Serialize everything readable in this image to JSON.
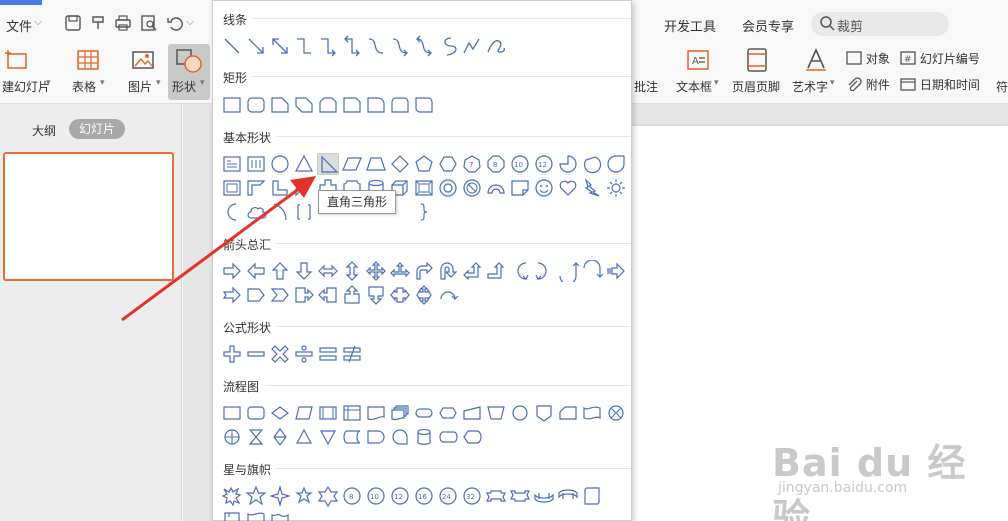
{
  "menubar": {
    "file": "文件",
    "dev_tools": "开发工具",
    "member": "会员专享",
    "search_placeholder": "裁剪"
  },
  "ribbon": {
    "new_slide": "建幻灯片",
    "table": "表格",
    "picture": "图片",
    "shape": "形状",
    "comment": "批注",
    "textbox": "文本框",
    "header_footer": "页眉页脚",
    "wordart": "艺术字",
    "object": "对象",
    "attachment": "附件",
    "slide_number": "幻灯片编号",
    "datetime": "日期和时间",
    "symbol": "符"
  },
  "left_panel": {
    "outline_tab": "大纲",
    "slides_tab": "幻灯片"
  },
  "dropdown": {
    "sections": {
      "lines": "线条",
      "rectangles": "矩形",
      "basic": "基本形状",
      "arrows": "箭头总汇",
      "equation": "公式形状",
      "flowchart": "流程图",
      "stars": "星与旗帜"
    }
  },
  "tooltip": "直角三角形",
  "watermark": {
    "brand": "Bai du 经验",
    "url": "jingyan.baidu.com"
  },
  "colors": {
    "accent_blue": "#4a7de0",
    "shape_stroke": "#4a6fb5",
    "arrow_red": "#e2322a",
    "thumb_border": "#e86b3a"
  }
}
